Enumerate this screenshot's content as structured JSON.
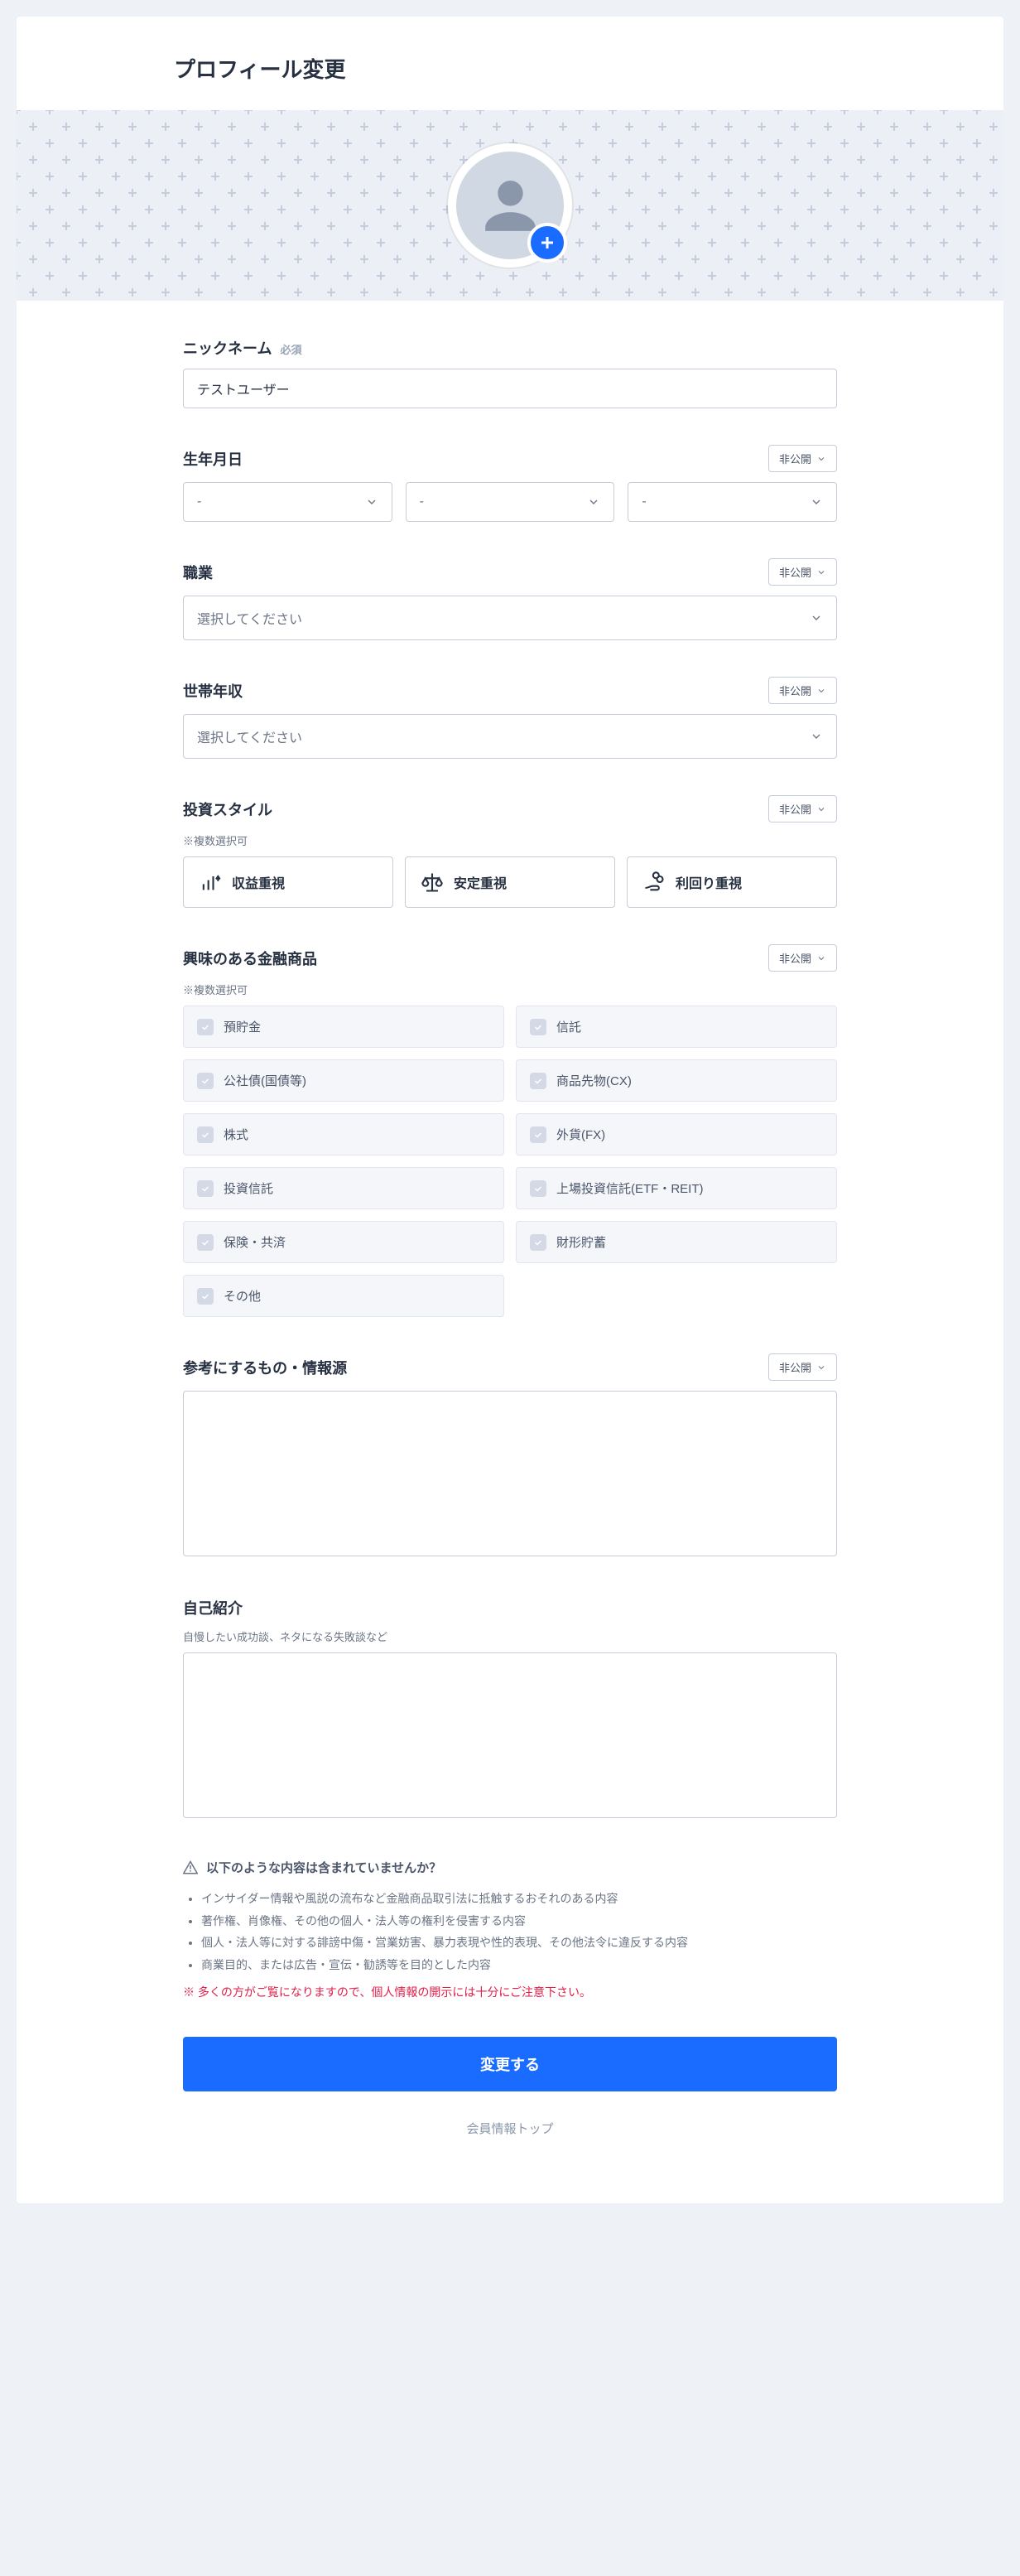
{
  "page_title": "プロフィール変更",
  "required_label": "必須",
  "privacy_toggle_label": "非公開",
  "nickname": {
    "label": "ニックネーム",
    "value": "テストユーザー"
  },
  "birthday": {
    "label": "生年月日",
    "year": "-",
    "month": "-",
    "day": "-"
  },
  "occupation": {
    "label": "職業",
    "placeholder": "選択してください"
  },
  "income": {
    "label": "世帯年収",
    "placeholder": "選択してください"
  },
  "invest_style": {
    "label": "投資スタイル",
    "hint": "※複数選択可",
    "options": [
      "収益重視",
      "安定重視",
      "利回り重視"
    ]
  },
  "products": {
    "label": "興味のある金融商品",
    "hint": "※複数選択可",
    "items": [
      "預貯金",
      "信託",
      "公社債(国債等)",
      "商品先物(CX)",
      "株式",
      "外貨(FX)",
      "投資信託",
      "上場投資信託(ETF・REIT)",
      "保険・共済",
      "財形貯蓄",
      "その他"
    ]
  },
  "references": {
    "label": "参考にするもの・情報源"
  },
  "bio": {
    "label": "自己紹介",
    "hint": "自慢したい成功談、ネタになる失敗談など"
  },
  "warning": {
    "title": "以下のような内容は含まれていませんか？",
    "items": [
      "インサイダー情報や風説の流布など金融商品取引法に抵触するおそれのある内容",
      "著作権、肖像権、その他の個人・法人等の権利を侵害する内容",
      "個人・法人等に対する誹謗中傷・営業妨害、暴力表現や性的表現、その他法令に違反する内容",
      "商業目的、または広告・宣伝・勧誘等を目的とした内容"
    ],
    "note": "※ 多くの方がご覧になりますので、個人情報の開示には十分にご注意下さい。"
  },
  "submit_label": "変更する",
  "back_link_label": "会員情報トップ"
}
